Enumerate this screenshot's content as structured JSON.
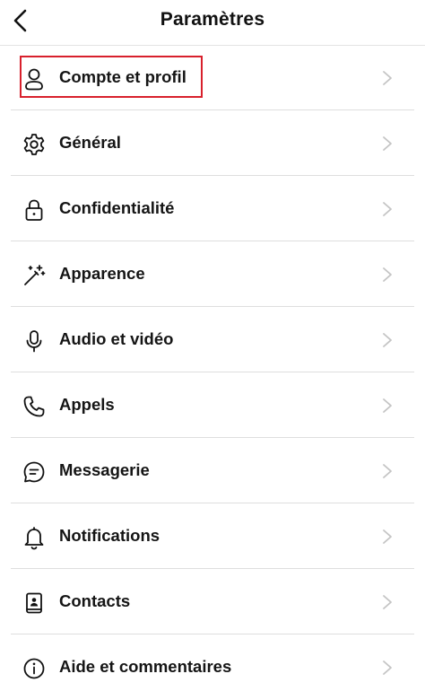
{
  "header": {
    "title": "Paramètres",
    "back_icon": "chevron-left-icon"
  },
  "settings": {
    "items": [
      {
        "label": "Compte et profil",
        "icon": "person-icon",
        "highlighted": true
      },
      {
        "label": "Général",
        "icon": "gear-icon"
      },
      {
        "label": "Confidentialité",
        "icon": "lock-icon"
      },
      {
        "label": "Apparence",
        "icon": "magic-wand-icon"
      },
      {
        "label": "Audio et vidéo",
        "icon": "microphone-icon"
      },
      {
        "label": "Appels",
        "icon": "phone-icon"
      },
      {
        "label": "Messagerie",
        "icon": "chat-bubble-icon"
      },
      {
        "label": "Notifications",
        "icon": "bell-icon"
      },
      {
        "label": "Contacts",
        "icon": "contact-card-icon"
      },
      {
        "label": "Aide et commentaires",
        "icon": "info-icon"
      }
    ]
  },
  "colors": {
    "highlight_border": "#d8202c",
    "separator": "#dedede",
    "chevron": "#c4c4c4",
    "text": "#151515"
  }
}
